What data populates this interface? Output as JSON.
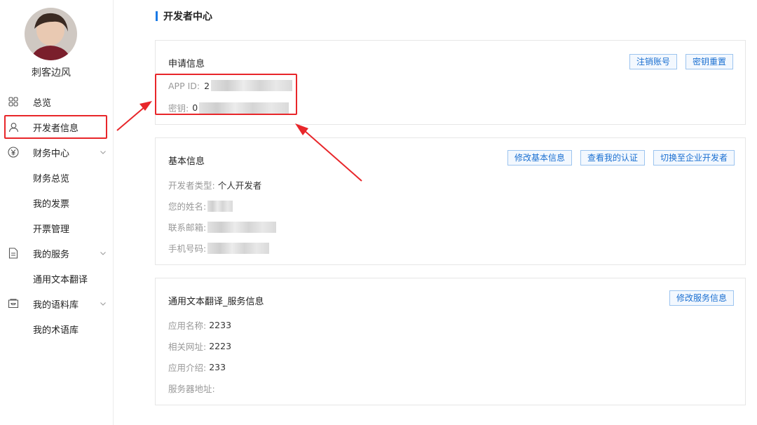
{
  "sidebar": {
    "username": "刺客边风",
    "items": [
      {
        "label": "总览",
        "icon": "grid-icon"
      },
      {
        "label": "开发者信息",
        "icon": "user-icon"
      },
      {
        "label": "财务中心",
        "icon": "yen-icon"
      },
      {
        "label": "财务总览"
      },
      {
        "label": "我的发票"
      },
      {
        "label": "开票管理"
      },
      {
        "label": "我的服务",
        "icon": "document-icon"
      },
      {
        "label": "通用文本翻译"
      },
      {
        "label": "我的语料库",
        "icon": "inbox-icon"
      },
      {
        "label": "我的术语库"
      }
    ]
  },
  "page": {
    "title": "开发者中心"
  },
  "apply_info": {
    "title": "申请信息",
    "btn_cancel_account": "注销账号",
    "btn_reset_key": "密钥重置",
    "app_id_label": "APP ID:",
    "app_id_value": "2",
    "key_label": "密钥:",
    "key_value": "0"
  },
  "basic_info": {
    "title": "基本信息",
    "btn_edit": "修改基本信息",
    "btn_view_cert": "查看我的认证",
    "btn_switch": "切换至企业开发者",
    "type_label": "开发者类型:",
    "type_value": "个人开发者",
    "name_label": "您的姓名:",
    "email_label": "联系邮箱:",
    "phone_label": "手机号码:"
  },
  "service_info": {
    "title": "通用文本翻译_服务信息",
    "btn_edit": "修改服务信息",
    "app_name_label": "应用名称:",
    "app_name_value": "2233",
    "url_label": "相关网址:",
    "url_value": "2223",
    "intro_label": "应用介绍:",
    "intro_value": "233",
    "server_label": "服务器地址:"
  },
  "colors": {
    "accent": "#1a7ae6",
    "highlight": "#e8262a"
  }
}
